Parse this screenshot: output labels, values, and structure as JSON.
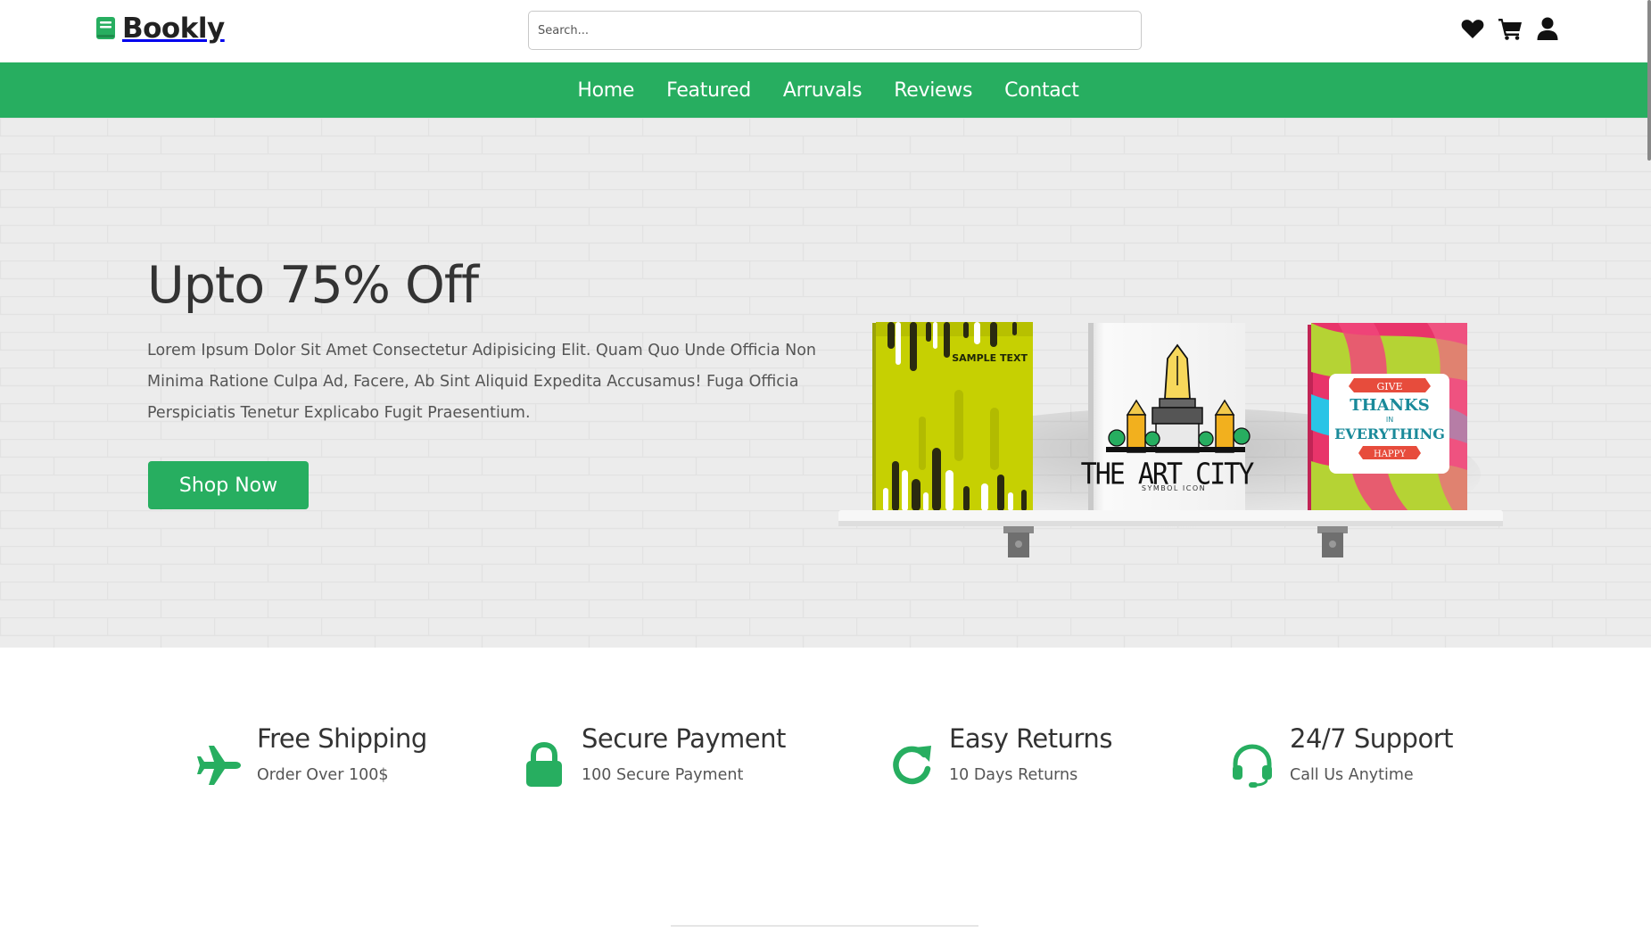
{
  "brand": {
    "name": "Bookly",
    "accent": "#27ae60"
  },
  "search": {
    "placeholder": "Search..."
  },
  "header_icons": [
    "heart-icon",
    "shopping-cart-icon",
    "user-icon"
  ],
  "nav": {
    "items": [
      "Home",
      "Featured",
      "Arruvals",
      "Reviews",
      "Contact"
    ]
  },
  "hero": {
    "title": "Upto 75% Off",
    "text": "Lorem Ipsum Dolor Sit Amet Consectetur Adipisicing Elit. Quam Quo Unde Officia Non Minima Ratione Culpa Ad, Facere, Ab Sint Aliquid Expedita Accusamus! Fuga Officia Perspiciatis Tenetur Explicabo Fugit Praesentium.",
    "button": "Shop Now",
    "books": {
      "book1": {
        "text": "SAMPLE TEXT"
      },
      "book2": {
        "title": "THE ART CITY",
        "subtitle": "SYMBOL ICON"
      },
      "book3": {
        "line1": "GIVE",
        "line2": "THANKS",
        "line3": "IN",
        "line4": "EVERYTHING",
        "line5": "HAPPY"
      }
    }
  },
  "features": [
    {
      "icon": "plane-icon",
      "title": "Free Shipping",
      "subtitle": "Order Over 100$"
    },
    {
      "icon": "lock-icon",
      "title": "Secure Payment",
      "subtitle": "100 Secure Payment"
    },
    {
      "icon": "redo-icon",
      "title": "Easy Returns",
      "subtitle": "10 Days Returns"
    },
    {
      "icon": "headset-icon",
      "title": "24/7 Support",
      "subtitle": "Call Us Anytime"
    }
  ]
}
